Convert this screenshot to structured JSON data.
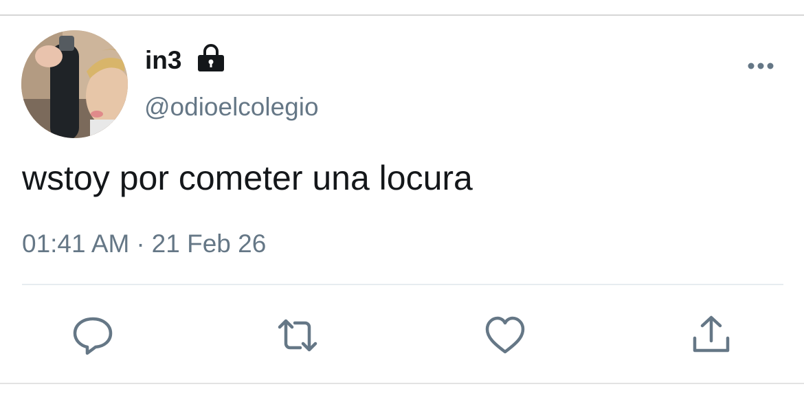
{
  "tweet": {
    "display_name": "in3",
    "handle": "@odioelcolegio",
    "text": "wstoy por cometer una locura",
    "time": "01:41 AM",
    "separator": "·",
    "date": "21 Feb 26"
  },
  "icons": {
    "lock": "lock-icon",
    "more": "more-horizontal-icon",
    "reply": "reply-icon",
    "retweet": "retweet-icon",
    "like": "heart-icon",
    "share": "share-icon"
  },
  "colors": {
    "text_primary": "#14171a",
    "text_secondary": "#657786",
    "icon": "#657786"
  }
}
